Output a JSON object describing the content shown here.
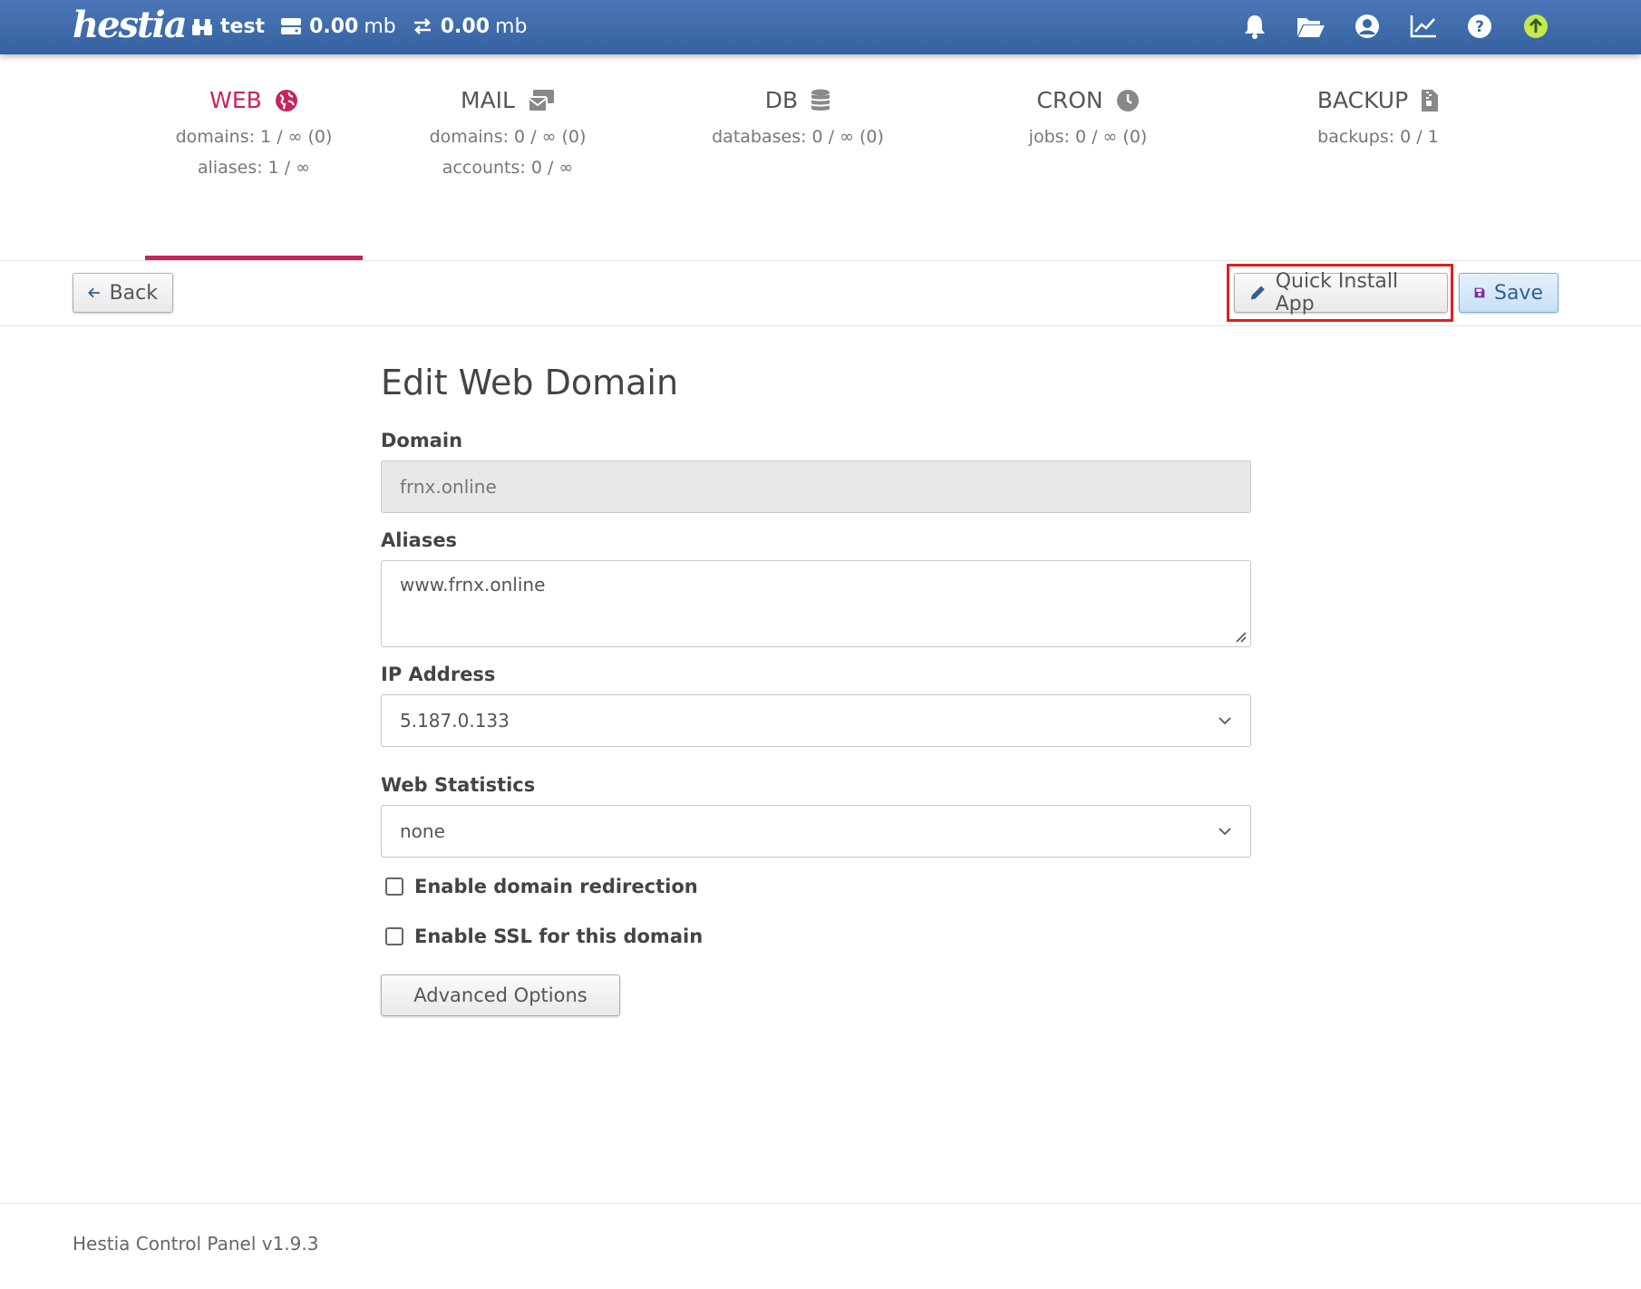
{
  "topbar": {
    "logo": "hestia",
    "user": "test",
    "disk": {
      "value": "0.00",
      "unit": "mb"
    },
    "bandwidth": {
      "value": "0.00",
      "unit": "mb"
    },
    "icons": [
      "bell-icon",
      "folder-open-icon",
      "user-circle-icon",
      "chart-line-icon",
      "help-circle-icon",
      "arrow-up-circle-icon"
    ],
    "update_color": "#c5e84a"
  },
  "tabs": [
    {
      "label": "WEB",
      "icon": "globe-icon",
      "lines": [
        "domains: 1 / ∞ (0)",
        "aliases: 1 / ∞"
      ],
      "active": true
    },
    {
      "label": "MAIL",
      "icon": "envelopes-icon",
      "lines": [
        "domains: 0 / ∞ (0)",
        "accounts: 0 / ∞"
      ]
    },
    {
      "label": "DB",
      "icon": "database-icon",
      "lines": [
        "databases: 0 / ∞ (0)"
      ]
    },
    {
      "label": "CRON",
      "icon": "clock-icon",
      "lines": [
        "jobs: 0 / ∞ (0)"
      ]
    },
    {
      "label": "BACKUP",
      "icon": "file-zipper-icon",
      "lines": [
        "backups: 0 / 1"
      ]
    }
  ],
  "accent_color": "#c7245d",
  "toolbar": {
    "back_label": "Back",
    "quick_install_label": "Quick Install App",
    "save_label": "Save"
  },
  "form": {
    "title": "Edit Web Domain",
    "domain_label": "Domain",
    "domain_value": "frnx.online",
    "aliases_label": "Aliases",
    "aliases_value": "www.frnx.online",
    "ip_label": "IP Address",
    "ip_value": "5.187.0.133",
    "stats_label": "Web Statistics",
    "stats_value": "none",
    "redirect_label": "Enable domain redirection",
    "ssl_label": "Enable SSL for this domain",
    "advanced_label": "Advanced Options"
  },
  "footer": {
    "text": "Hestia Control Panel v1.9.3"
  }
}
